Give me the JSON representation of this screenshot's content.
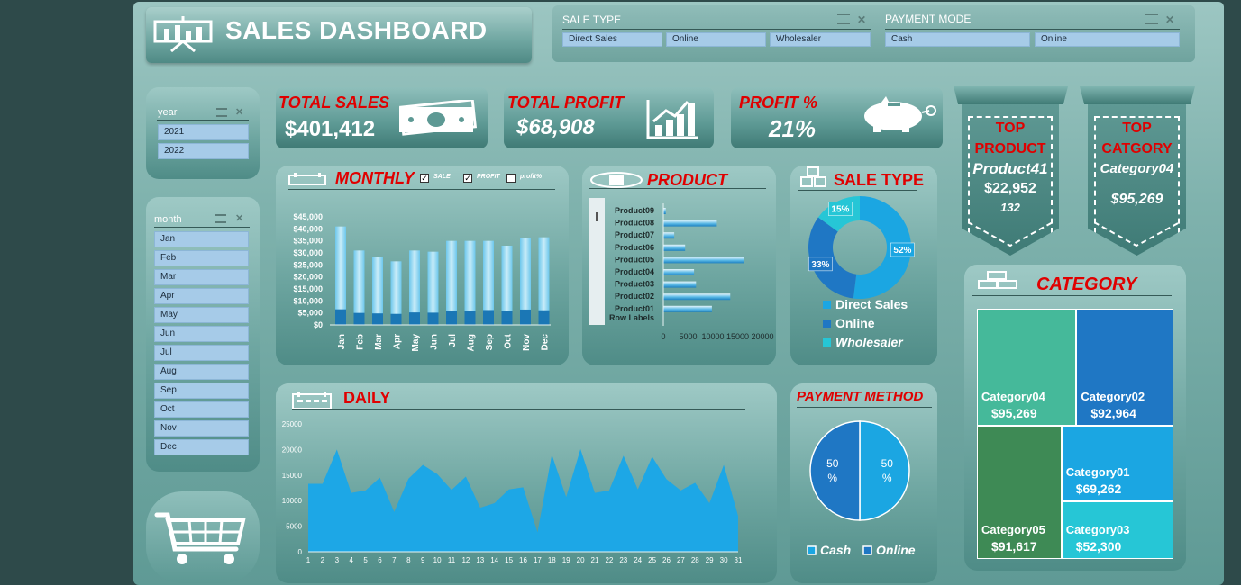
{
  "header": {
    "title": "SALES DASHBOARD",
    "icon": "presentation-board-icon"
  },
  "sale_type_slicer": {
    "title": "SALE TYPE",
    "options": [
      "Direct Sales",
      "Online",
      "Wholesaler"
    ]
  },
  "payment_mode_slicer": {
    "title": "PAYMENT MODE",
    "options": [
      "Cash",
      "Online"
    ]
  },
  "year_slicer": {
    "title": "year",
    "options": [
      "2021",
      "2022"
    ]
  },
  "month_slicer": {
    "title": "month",
    "options": [
      "Jan",
      "Feb",
      "Mar",
      "Apr",
      "May",
      "Jun",
      "Jul",
      "Aug",
      "Sep",
      "Oct",
      "Nov",
      "Dec"
    ]
  },
  "kpis": {
    "total_sales": {
      "label": "TOTAL SALES",
      "value": "$401,412",
      "icon": "money-bill-icon"
    },
    "total_profit": {
      "label": "TOTAL PROFIT",
      "value": "$68,908",
      "icon": "growth-chart-icon"
    },
    "profit_pct": {
      "label": "PROFIT %",
      "value": "21%",
      "icon": "piggy-bank-icon"
    }
  },
  "top_product": {
    "line1": "TOP",
    "line2": "PRODUCT",
    "name": "Product41",
    "value": "$22,952",
    "count": "132"
  },
  "top_category": {
    "line1": "TOP",
    "line2": "CATGORY",
    "name": "Category04",
    "value": "$95,269"
  },
  "monthly": {
    "title": "MONTHLY",
    "checkboxes": [
      {
        "label": "SALE",
        "checked": true
      },
      {
        "label": "PROFIT",
        "checked": true
      },
      {
        "label": "profit%",
        "checked": false
      }
    ]
  },
  "product": {
    "title": "PRODUCT",
    "row_labels": "Row Labels"
  },
  "sale_type": {
    "title": "SALE TYPE"
  },
  "daily": {
    "title": "DAILY"
  },
  "payment": {
    "title": "PAYMENT METHOD"
  },
  "category": {
    "title": "CATEGORY"
  },
  "colors": {
    "accent_red": "#e00000",
    "blue_dark": "#1f77c4",
    "blue_mid": "#1ba6e2",
    "cyan": "#26c6d6",
    "green_light": "#45b99a",
    "green_dark": "#3e8a55"
  },
  "chart_data": [
    {
      "id": "monthly",
      "type": "bar",
      "categories": [
        "Jan",
        "Feb",
        "Mar",
        "Apr",
        "May",
        "Jun",
        "Jul",
        "Aug",
        "Sep",
        "Oct",
        "Nov",
        "Dec"
      ],
      "series": [
        {
          "name": "SALE",
          "values": [
            41000,
            31000,
            28500,
            26500,
            31000,
            30500,
            35000,
            35000,
            35000,
            33000,
            36000,
            36500
          ]
        },
        {
          "name": "PROFIT",
          "values": [
            6500,
            5000,
            4800,
            4600,
            5200,
            5100,
            5800,
            5900,
            6200,
            5700,
            6400,
            6100
          ]
        }
      ],
      "yticks": [
        "$45,000",
        "$40,000",
        "$35,000",
        "$30,000",
        "$25,000",
        "$20,000",
        "$15,000",
        "$10,000",
        "$5,000",
        "$0"
      ],
      "ylim": [
        0,
        45000
      ]
    },
    {
      "id": "product",
      "type": "bar",
      "orientation": "horizontal",
      "categories": [
        "Product09",
        "Product08",
        "Product07",
        "Product06",
        "Product05",
        "Product04",
        "Product03",
        "Product02",
        "Product01"
      ],
      "values": [
        500,
        10800,
        2200,
        4400,
        16200,
        6200,
        6600,
        13500,
        9800
      ],
      "xticks": [
        "0",
        "5000",
        "10000",
        "15000",
        "20000"
      ],
      "xlim": [
        0,
        20000
      ]
    },
    {
      "id": "sale_type",
      "type": "pie",
      "donut": true,
      "labels": [
        "Direct Sales",
        "Online",
        "Wholesaler"
      ],
      "values": [
        52,
        33,
        15
      ],
      "value_labels": [
        "52%",
        "33%",
        "15%"
      ]
    },
    {
      "id": "daily",
      "type": "area",
      "x": [
        1,
        2,
        3,
        4,
        5,
        6,
        7,
        8,
        9,
        10,
        11,
        12,
        13,
        14,
        15,
        16,
        17,
        18,
        19,
        20,
        21,
        22,
        23,
        24,
        25,
        26,
        27,
        28,
        29,
        30,
        31
      ],
      "values": [
        13300,
        13300,
        20000,
        11500,
        12000,
        14500,
        7800,
        14300,
        17000,
        15200,
        12100,
        14700,
        8600,
        9500,
        12200,
        12600,
        3800,
        19000,
        10700,
        20100,
        11500,
        12000,
        18800,
        12200,
        18600,
        14200,
        12000,
        13500,
        9500,
        17000,
        7000
      ],
      "yticks": [
        "25000",
        "20000",
        "15000",
        "10000",
        "5000",
        "0"
      ],
      "ylim": [
        0,
        25000
      ]
    },
    {
      "id": "payment",
      "type": "pie",
      "labels": [
        "Cash",
        "Online"
      ],
      "values": [
        50,
        50
      ],
      "value_labels": [
        "50\n%",
        "50\n%"
      ]
    },
    {
      "id": "category",
      "type": "treemap",
      "labels": [
        "Category04",
        "Category02",
        "Category05",
        "Category01",
        "Category03"
      ],
      "values": [
        95269,
        92964,
        91617,
        69262,
        52300
      ],
      "value_labels": [
        "$95,269",
        "$92,964",
        "$91,617",
        "$69,262",
        "$52,300"
      ]
    }
  ]
}
